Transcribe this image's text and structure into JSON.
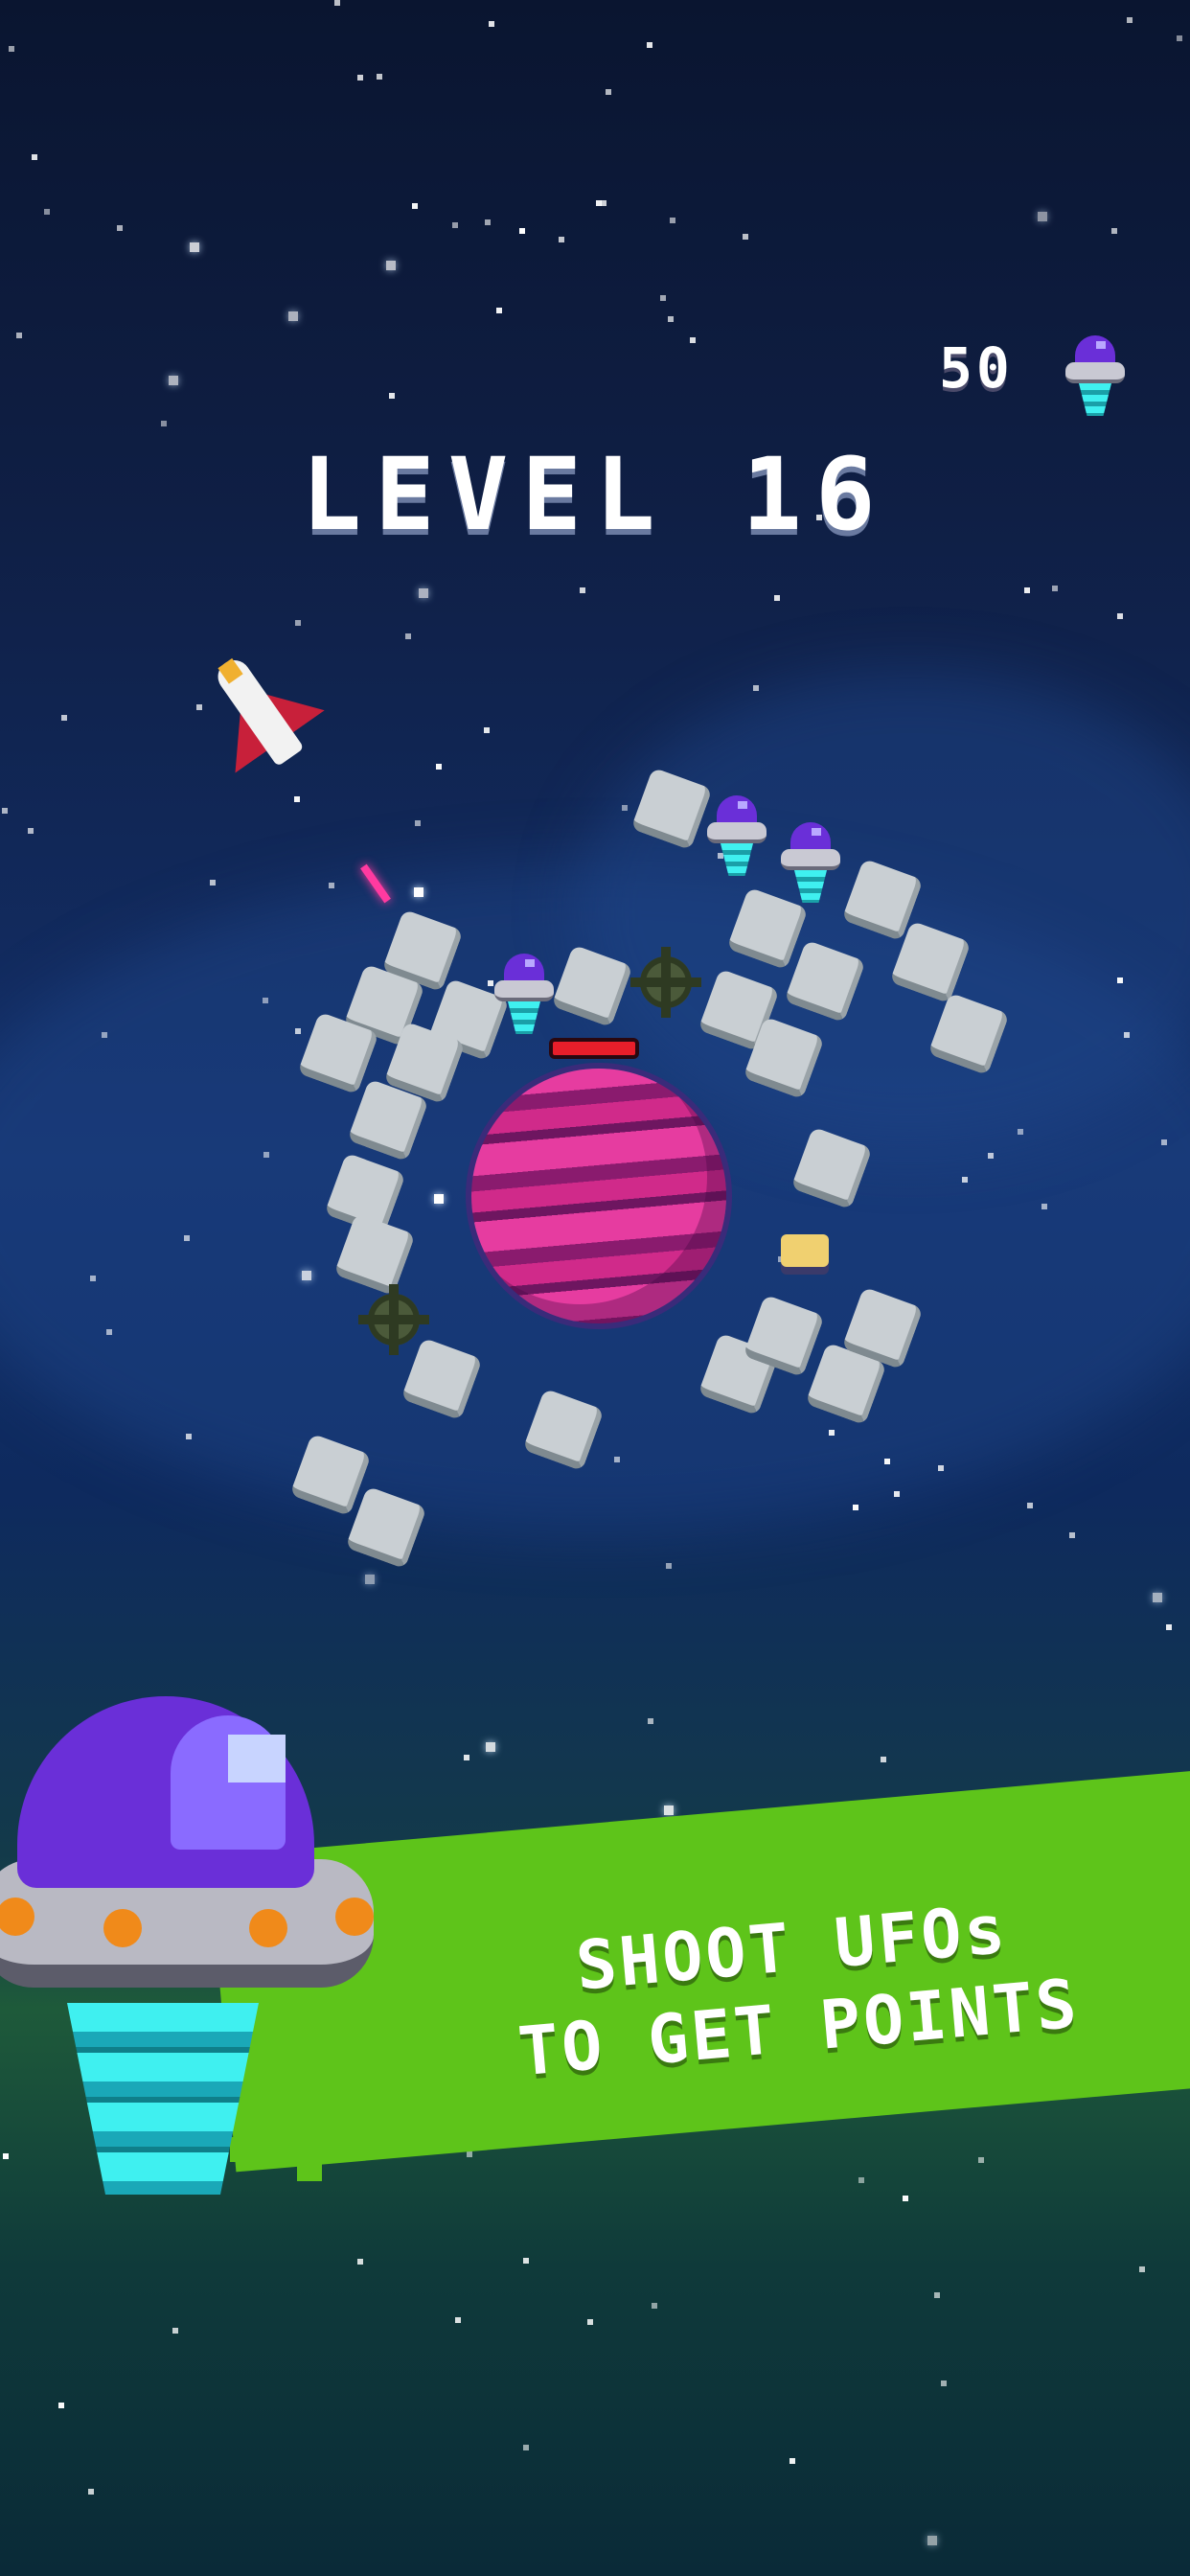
{
  "hud": {
    "score": "50",
    "score_icon": "ufo-icon",
    "level_text": "LEVEL 16"
  },
  "promo": {
    "line1": "SHOOT UFOs",
    "line2": "TO GET POINTS"
  },
  "boss": {
    "health_fraction": 1.0
  },
  "colors": {
    "banner": "#5ec41a",
    "planet": "#e63ca0",
    "health_bar": "#e81e2a"
  }
}
